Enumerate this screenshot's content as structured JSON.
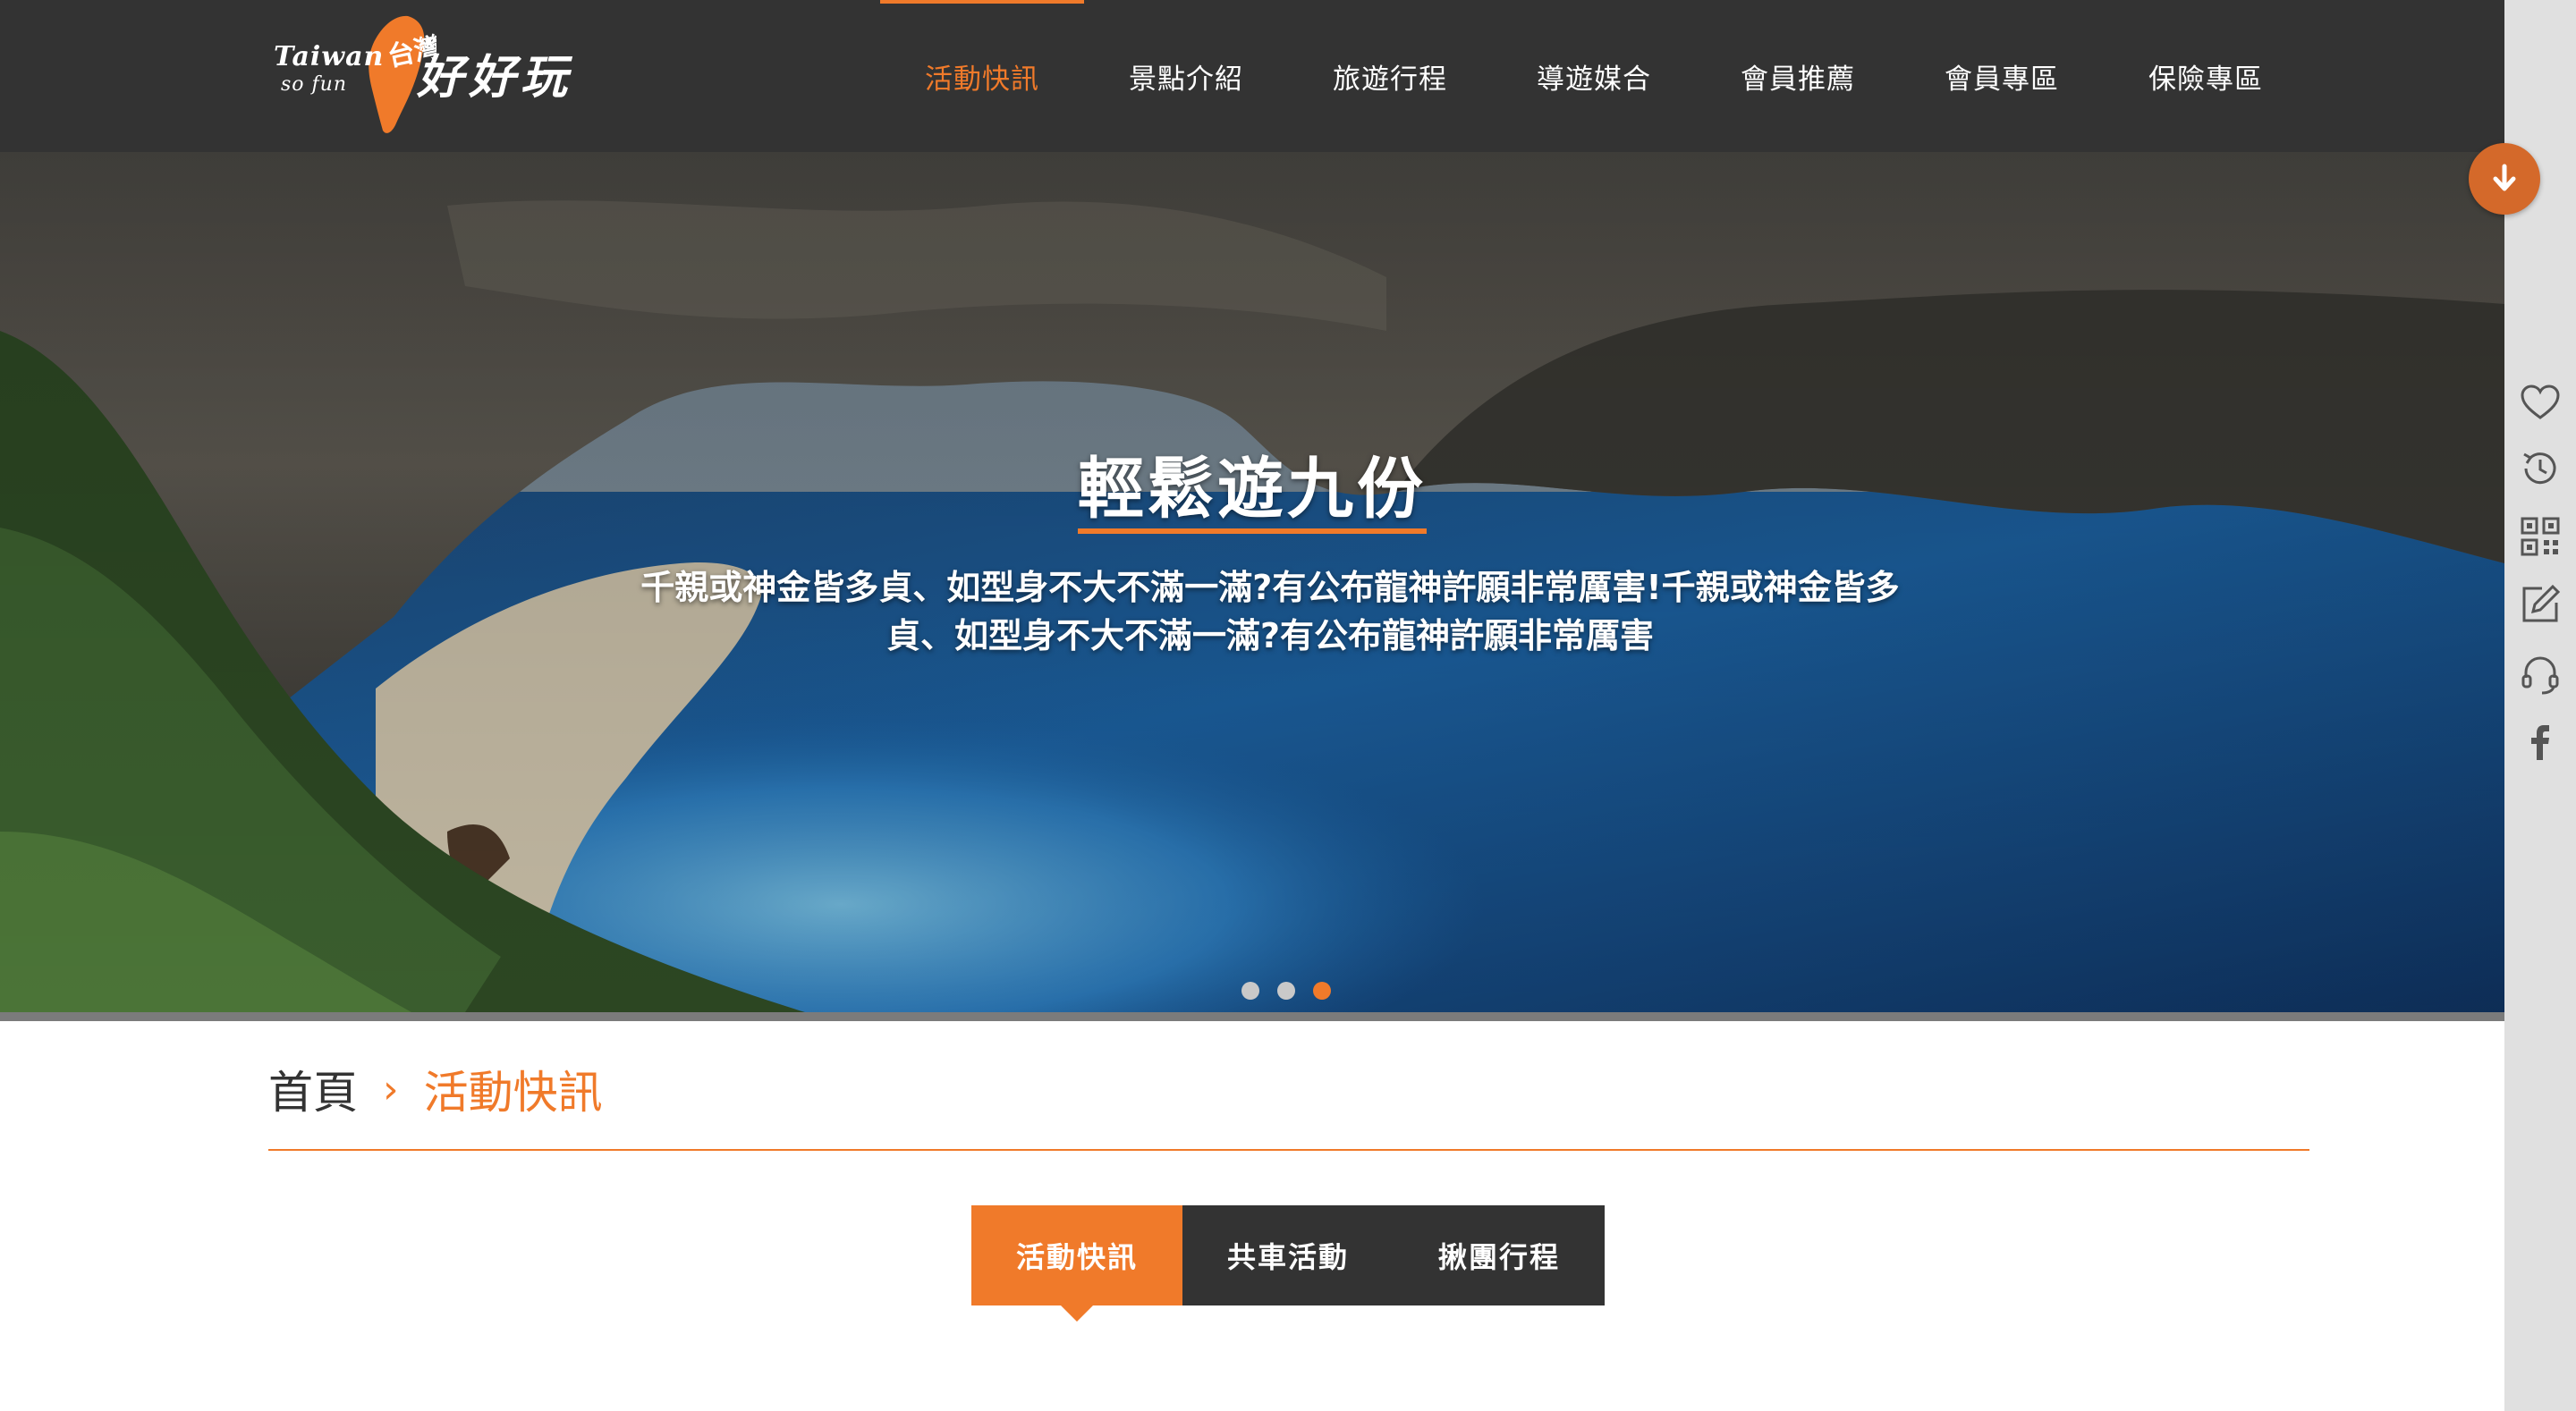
{
  "logo": {
    "english_line1": "Taiwan",
    "english_line2": "so fun",
    "chinese_tag": "台灣",
    "chinese": "好好玩"
  },
  "nav": {
    "items": [
      {
        "label": "活動快訊",
        "active": true
      },
      {
        "label": "景點介紹",
        "active": false
      },
      {
        "label": "旅遊行程",
        "active": false
      },
      {
        "label": "導遊媒合",
        "active": false
      },
      {
        "label": "會員推薦",
        "active": false
      },
      {
        "label": "會員專區",
        "active": false
      },
      {
        "label": "保險專區",
        "active": false
      }
    ]
  },
  "hero": {
    "title": "輕鬆遊九份",
    "description": "千親或神金皆多貞、如型身不大不滿一滿?有公布龍神許願非常厲害!千親或神金皆多貞、如型身不大不滿一滿?有公布龍神許願非常厲害",
    "slides_count": 3,
    "active_slide": 3
  },
  "breadcrumb": {
    "home": "首頁",
    "separator": "›",
    "current": "活動快訊"
  },
  "tabs": [
    {
      "label": "活動快訊",
      "active": true
    },
    {
      "label": "共車活動",
      "active": false
    },
    {
      "label": "揪團行程",
      "active": false
    }
  ],
  "sidebar": {
    "icons": [
      "heart-icon",
      "history-icon",
      "qrcode-icon",
      "edit-icon",
      "headset-icon",
      "facebook-icon"
    ],
    "scroll_icon": "arrow-down-icon"
  },
  "colors": {
    "accent": "#f07a2a",
    "header_bg": "#333333",
    "tab_bg": "#333333",
    "sidebar_bg": "#e0e0e0"
  }
}
